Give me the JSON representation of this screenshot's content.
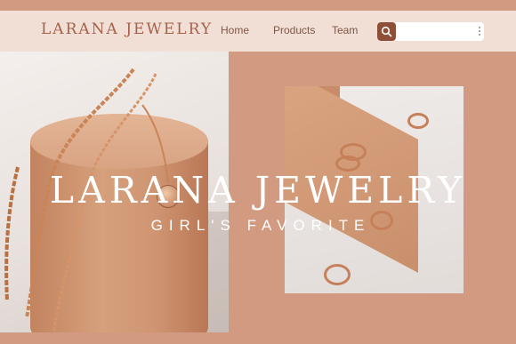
{
  "brand": {
    "logo_text": "LARANA JEWELRY"
  },
  "nav": {
    "items": [
      {
        "label": "Home"
      },
      {
        "label": "Products"
      },
      {
        "label": "Team"
      }
    ]
  },
  "search": {
    "placeholder": "",
    "value": "",
    "button_icon": "search-icon",
    "menu_icon": "kebab-menu-icon"
  },
  "hero": {
    "title": "LARANA JEWELRY",
    "subtitle": "GIRL'S FAVORITE"
  },
  "colors": {
    "background": "#d29a80",
    "header": "#f1dfd6",
    "accent": "#8e4f39",
    "logo": "#a5614b"
  }
}
